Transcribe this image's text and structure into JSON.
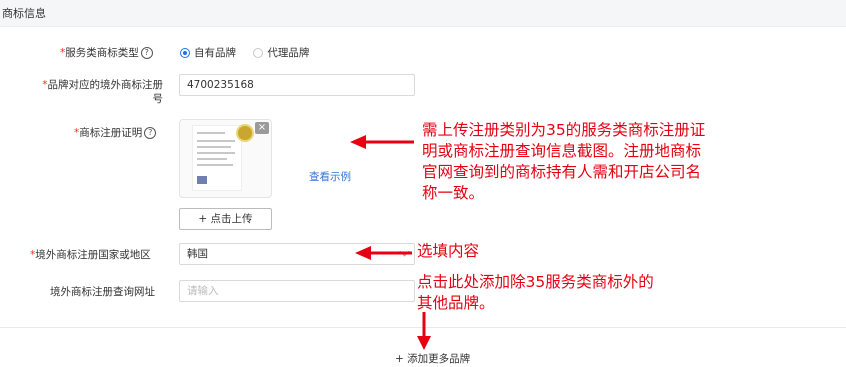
{
  "section_title": "商标信息",
  "fields": {
    "service_type": {
      "required": "*",
      "label": "服务类商标类型",
      "help": "?",
      "options": [
        {
          "label": "自有品牌",
          "selected": true
        },
        {
          "label": "代理品牌",
          "selected": false
        }
      ]
    },
    "overseas_reg_no": {
      "required": "*",
      "label_line1": "品牌对应的境外商标注册",
      "label_line2": "号",
      "value": "4700235168"
    },
    "reg_certificate": {
      "required": "*",
      "label": "商标注册证明",
      "help": "?",
      "close_glyph": "×",
      "example_link": "查看示例",
      "upload_label": "+ 点击上传"
    },
    "reg_region": {
      "required": "*",
      "label": "境外商标注册国家或地区",
      "value": "韩国"
    },
    "query_url": {
      "label": "境外商标注册查询网址",
      "placeholder": "请输入"
    }
  },
  "add_more_label": "+ 添加更多品牌",
  "annotations": {
    "certificate_note": [
      "需上传注册类别为35的服务类商标注册证",
      "明或商标注册查询信息截图。注册地商标",
      "官网查询到的商标持有人需和开店公司名",
      "称一致。"
    ],
    "optional_note": "选填内容",
    "add_more_note": [
      "点击此处添加除35服务类商标外的",
      "其他品牌。"
    ]
  },
  "colors": {
    "accent_blue": "#1f6ff2",
    "annotation_red": "#e60012",
    "link_blue": "#2f76d2"
  }
}
